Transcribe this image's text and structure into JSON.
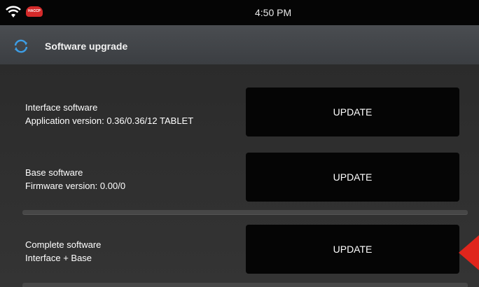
{
  "status_bar": {
    "time": "4:50 PM",
    "badge": "HACCP"
  },
  "header": {
    "title": "Software upgrade",
    "icon": "sync-icon"
  },
  "items": [
    {
      "name": "Interface software",
      "detail": "Application version: 0.36/0.36/12 TABLET",
      "button": "UPDATE"
    },
    {
      "name": "Base software",
      "detail": "Firmware version: 0.00/0",
      "button": "UPDATE"
    },
    {
      "name": "Complete software",
      "detail": "Interface + Base",
      "button": "UPDATE"
    }
  ],
  "colors": {
    "accent": "#3d9ee6",
    "pointer": "#e0251c",
    "badge": "#d42a2a"
  }
}
